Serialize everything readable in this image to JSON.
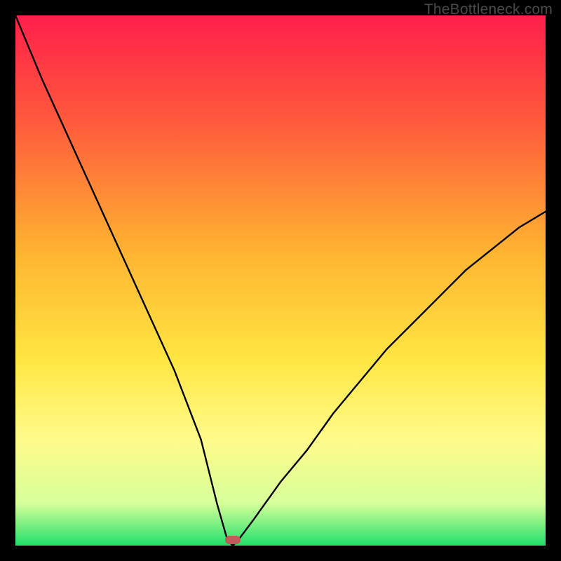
{
  "watermark": "TheBottleneck.com",
  "chart_data": {
    "type": "line",
    "title": "",
    "xlabel": "",
    "ylabel": "",
    "xlim": [
      0,
      100
    ],
    "ylim": [
      0,
      100
    ],
    "grid": false,
    "series": [
      {
        "name": "bottleneck-curve",
        "x": [
          0,
          5,
          10,
          15,
          20,
          25,
          30,
          35,
          38,
          40,
          41,
          42,
          45,
          50,
          55,
          60,
          65,
          70,
          75,
          80,
          85,
          90,
          95,
          100
        ],
        "y": [
          100,
          88,
          77,
          66,
          55,
          44,
          33,
          20,
          8,
          1,
          0,
          1,
          5,
          12,
          18,
          25,
          31,
          37,
          42,
          47,
          52,
          56,
          60,
          63
        ]
      }
    ],
    "marker": {
      "x": 41,
      "y": 1,
      "shape": "pill",
      "color": "#c15b5b"
    },
    "background_gradient": {
      "stops": [
        {
          "offset": 0.0,
          "color": "#ff1f4b"
        },
        {
          "offset": 0.2,
          "color": "#ff5a3c"
        },
        {
          "offset": 0.45,
          "color": "#ffb531"
        },
        {
          "offset": 0.65,
          "color": "#ffe642"
        },
        {
          "offset": 0.8,
          "color": "#fffb8a"
        },
        {
          "offset": 0.92,
          "color": "#d6ff9a"
        },
        {
          "offset": 1.0,
          "color": "#22e06a"
        }
      ]
    }
  }
}
